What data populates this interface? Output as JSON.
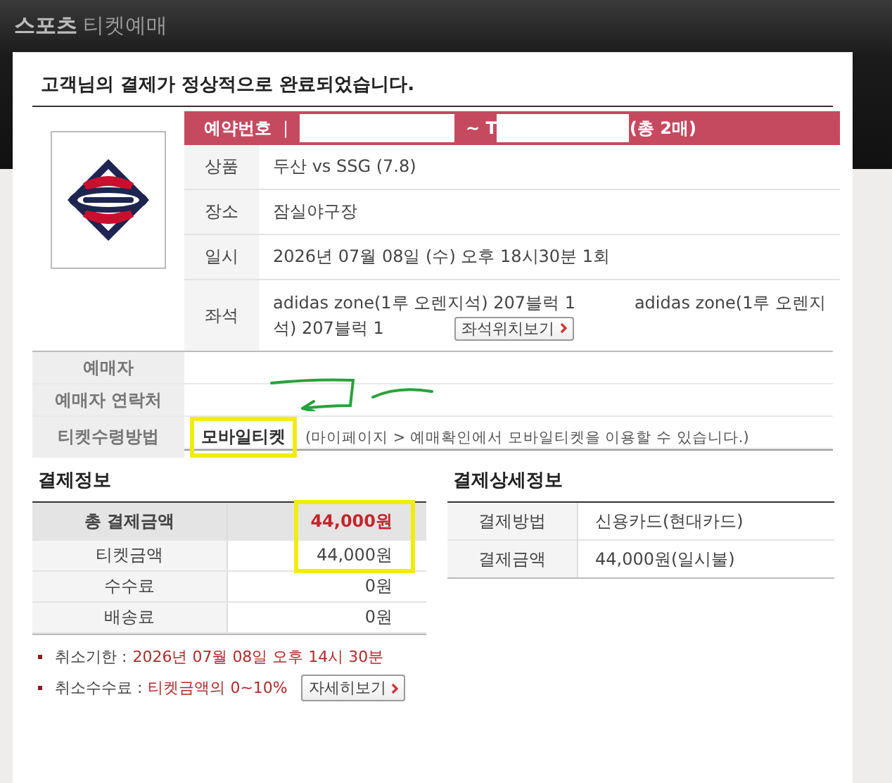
{
  "header": {
    "brand": "스포츠",
    "title": "티켓예매"
  },
  "message": "고객님의 결제가 정상적으로 완료되었습니다.",
  "reservation": {
    "label": "예약번호",
    "divider": "|",
    "separator": "~ T",
    "count": "(총 2매)"
  },
  "details": [
    {
      "label": "상품",
      "value": "두산 vs SSG (7.8)"
    },
    {
      "label": "장소",
      "value": "잠실야구장"
    },
    {
      "label": "일시",
      "value": "2026년 07월 08일 (수) 오후 18시30분 1회"
    }
  ],
  "seat": {
    "label": "좌석",
    "lines": [
      [
        "adidas zone(1루 오렌지석) 207블럭 1",
        "adidas zone(1루 오렌지"
      ],
      [
        "석) 207블럭 1"
      ]
    ],
    "button": "좌석위치보기"
  },
  "booker": [
    {
      "label": "예매자"
    },
    {
      "label": "예매자 연락처"
    },
    {
      "label": "티켓수령방법",
      "value": "모바일티켓",
      "note": "(마이페이지 > 예매확인에서 모바일티켓을 이용할 수 있습니다.)"
    }
  ],
  "payment": {
    "title": "결제정보",
    "rows": [
      {
        "kind": "total",
        "label": "총 결제금액",
        "value": "44,000원"
      },
      {
        "kind": "item",
        "label": "티켓금액",
        "value": "44,000원"
      },
      {
        "kind": "item",
        "label": "수수료",
        "value": "0원"
      },
      {
        "kind": "item",
        "label": "배송료",
        "value": "0원"
      }
    ]
  },
  "payment_detail": {
    "title": "결제상세정보",
    "rows": [
      {
        "label": "결제방법",
        "value": "신용카드(현대카드)"
      },
      {
        "label": "결제금액",
        "value": "44,000원(일시불)"
      }
    ]
  },
  "notes": [
    {
      "label": "취소기한 :",
      "value": "2026년 07월 08일 오후 14시 30분"
    },
    {
      "label": "취소수수료 :",
      "value": "티켓금액의 0~10%",
      "button": "자세히보기"
    }
  ]
}
